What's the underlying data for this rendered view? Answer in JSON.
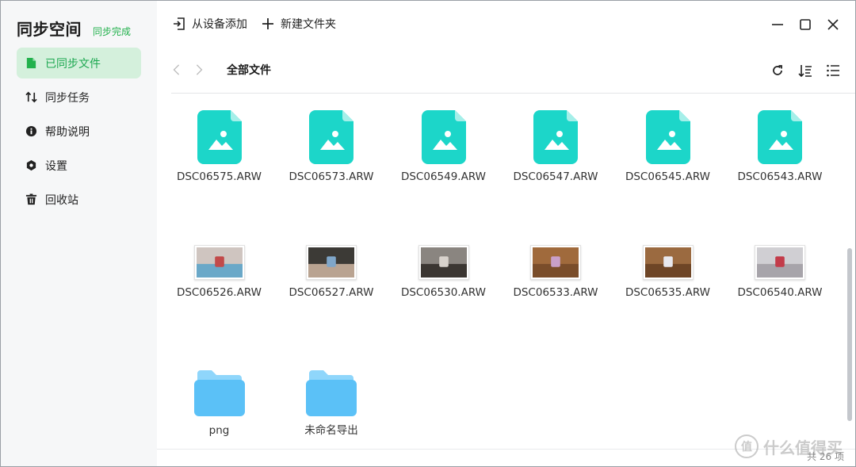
{
  "app": {
    "title": "同步空间",
    "status": "同步完成"
  },
  "sidebar": {
    "items": [
      {
        "label": "已同步文件",
        "icon": "file-icon",
        "active": true
      },
      {
        "label": "同步任务",
        "icon": "sync-arrows-icon",
        "active": false
      },
      {
        "label": "帮助说明",
        "icon": "info-icon",
        "active": false
      },
      {
        "label": "设置",
        "icon": "hexagon-gear-icon",
        "active": false
      },
      {
        "label": "回收站",
        "icon": "trash-icon",
        "active": false
      }
    ]
  },
  "toolbar": {
    "add_from_device": "从设备添加",
    "new_folder": "新建文件夹"
  },
  "path": {
    "current": "全部文件"
  },
  "files": [
    {
      "name": "DSC06575.ARW",
      "kind": "raw"
    },
    {
      "name": "DSC06573.ARW",
      "kind": "raw"
    },
    {
      "name": "DSC06549.ARW",
      "kind": "raw"
    },
    {
      "name": "DSC06547.ARW",
      "kind": "raw"
    },
    {
      "name": "DSC06545.ARW",
      "kind": "raw"
    },
    {
      "name": "DSC06543.ARW",
      "kind": "raw"
    },
    {
      "name": "DSC06526.ARW",
      "kind": "photo",
      "colors": [
        "#cfc5c0",
        "#6aa8c8",
        "#c24a4a"
      ]
    },
    {
      "name": "DSC06527.ARW",
      "kind": "photo",
      "colors": [
        "#3c3a36",
        "#b9a391",
        "#7fa6c9"
      ]
    },
    {
      "name": "DSC06530.ARW",
      "kind": "photo",
      "colors": [
        "#8a8580",
        "#3b3632",
        "#d8d2cc"
      ]
    },
    {
      "name": "DSC06533.ARW",
      "kind": "photo",
      "colors": [
        "#a06a3c",
        "#7a4d2a",
        "#c9a0c9"
      ]
    },
    {
      "name": "DSC06535.ARW",
      "kind": "photo",
      "colors": [
        "#9b6a40",
        "#6e4526",
        "#e8e8ee"
      ]
    },
    {
      "name": "DSC06540.ARW",
      "kind": "photo",
      "colors": [
        "#d0cfd3",
        "#a7a4aa",
        "#c33c4a"
      ]
    },
    {
      "name": "png",
      "kind": "folder"
    },
    {
      "name": "未命名导出",
      "kind": "folder"
    }
  ],
  "status": {
    "count": "共 26 项"
  },
  "watermark": {
    "text": "什么值得买",
    "logo": "值"
  },
  "colors": {
    "accent": "#22b14c",
    "raw_icon": "#1cd6c9",
    "folder": "#5bc1f7"
  }
}
